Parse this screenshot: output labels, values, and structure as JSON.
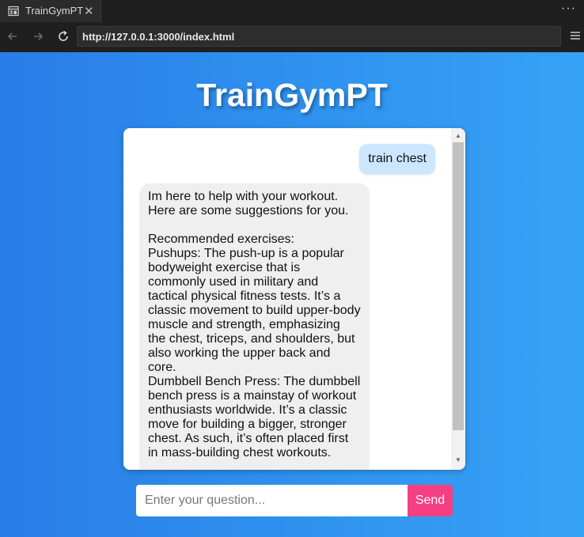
{
  "browser": {
    "tab_title": "TrainGymPT",
    "tab_close": "✕",
    "more_menu": "···",
    "url": "http://127.0.0.1:3000/index.html"
  },
  "app": {
    "title": "TrainGymPT"
  },
  "chat": {
    "user_message": "train chest",
    "bot_message": {
      "intro_line1": "Im here to help with your workout.",
      "intro_line2": "Here are some suggestions for you.",
      "heading": "Recommended exercises:",
      "exercise1": "Pushups: The push-up is a popular bodyweight exercise that is commonly used in military and tactical physical fitness tests. It’s a classic movement to build upper-body muscle and strength, emphasizing the chest, triceps, and shoulders, but also working the upper back and core.",
      "exercise2": "Dumbbell Bench Press: The dumbbell bench press is a mainstay of workout enthusiasts worldwide. It’s a classic move for building a bigger, stronger chest. As such, it’s often placed first in mass-building chest workouts."
    }
  },
  "input": {
    "placeholder": "Enter your question...",
    "value": "",
    "send_label": "Send"
  },
  "colors": {
    "send_button": "#f43f82",
    "user_bubble": "#cde6ff",
    "bot_bubble": "#efefef",
    "page_gradient_start": "#2a7de7",
    "page_gradient_end": "#36a2f5"
  }
}
